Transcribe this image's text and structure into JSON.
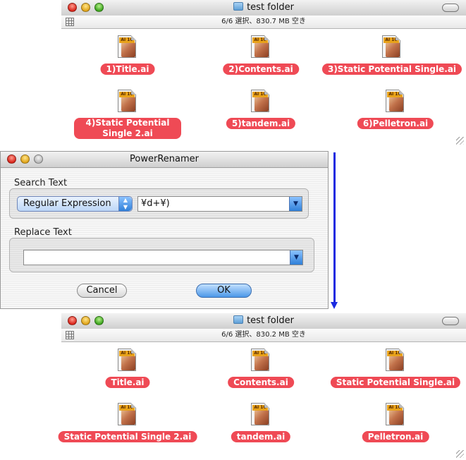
{
  "window_before": {
    "title": "test folder",
    "status": "6/6 選択、830.7 MB 空き",
    "files": [
      {
        "label": "1)Title.ai",
        "badge": "AI 10"
      },
      {
        "label": "2)Contents.ai",
        "badge": "AI 10"
      },
      {
        "label": "3)Static Potential Single.ai",
        "badge": "AI 10"
      },
      {
        "label": "4)Static Potential Single 2.ai",
        "badge": "AI 10"
      },
      {
        "label": "5)tandem.ai",
        "badge": "AI 10"
      },
      {
        "label": "6)Pelletron.ai",
        "badge": "AI 10"
      }
    ]
  },
  "dialog": {
    "title": "PowerRenamer",
    "search_group_label": "Search Text",
    "search_mode": "Regular Expression",
    "search_value": "¥d+¥)",
    "replace_group_label": "Replace Text",
    "replace_value": "",
    "cancel_label": "Cancel",
    "ok_label": "OK"
  },
  "window_after": {
    "title": "test folder",
    "status": "6/6 選択、830.2 MB 空き",
    "files": [
      {
        "label": "Title.ai",
        "badge": "AI 10"
      },
      {
        "label": "Contents.ai",
        "badge": "AI 10"
      },
      {
        "label": "Static Potential Single.ai",
        "badge": "AI 10"
      },
      {
        "label": "Static Potential Single 2.ai",
        "badge": "AI 10"
      },
      {
        "label": "tandem.ai",
        "badge": "AI 10"
      },
      {
        "label": "Pelletron.ai",
        "badge": "AI 10"
      }
    ]
  },
  "colors": {
    "selection_label": "#ef4a55",
    "arrow": "#1a2ae0",
    "ok_button": "#4b97e8"
  },
  "icons": {
    "file": "illustrator-file-icon",
    "folder": "folder-icon"
  }
}
